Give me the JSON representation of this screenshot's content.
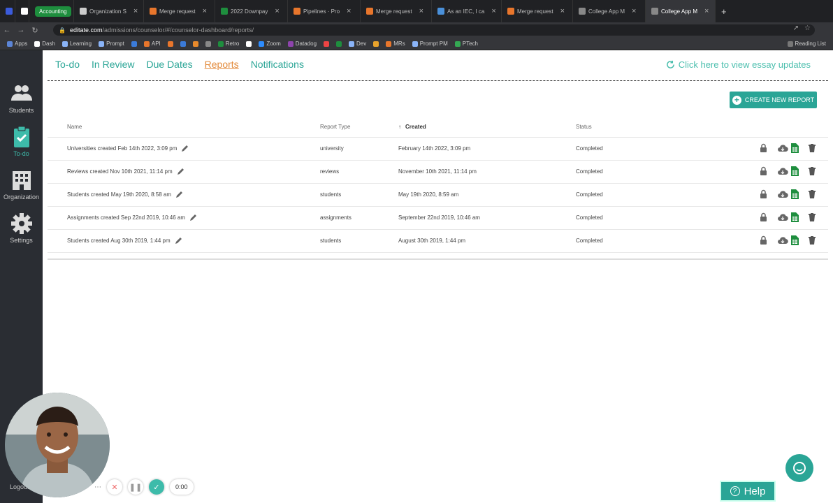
{
  "browser": {
    "tabs": [
      {
        "label": "",
        "icon": "word-icon",
        "color": "#3b5bdb"
      },
      {
        "label": "",
        "icon": "notion-icon",
        "color": "#ffffff"
      },
      {
        "label": "Accounting",
        "group": true
      },
      {
        "label": "Organization S",
        "icon": "doc-icon",
        "color": "#ccc"
      },
      {
        "label": "Merge request",
        "icon": "gitlab-icon",
        "color": "#e8762c"
      },
      {
        "label": "2022 Downpay",
        "icon": "sheets-icon",
        "color": "#1e8e3e"
      },
      {
        "label": "Pipelines · Pro",
        "icon": "gitlab-icon",
        "color": "#e8762c"
      },
      {
        "label": "Merge request",
        "icon": "gitlab-icon",
        "color": "#e8762c"
      },
      {
        "label": "As an IEC, I ca",
        "icon": "doc-icon",
        "color": "#4a90d9"
      },
      {
        "label": "Merge request",
        "icon": "gitlab-icon",
        "color": "#e8762c"
      },
      {
        "label": "College App M",
        "icon": "app-icon",
        "color": "#888"
      },
      {
        "label": "College App M",
        "icon": "app-icon",
        "color": "#888",
        "active": true
      }
    ],
    "url_host": "editate.com",
    "url_path": "/admissions/counselor/#/counselor-dashboard/reports/",
    "bookmarks": [
      "Apps",
      "Dash",
      "Learning",
      "Prompt",
      "",
      "API",
      "",
      "",
      "",
      "",
      "Retro",
      "",
      "Zoom",
      "Datadog",
      "",
      "",
      "Dev",
      "",
      "MRs",
      "Prompt PM",
      "PTech"
    ],
    "reading_list": "Reading List"
  },
  "sidebar": {
    "items": [
      {
        "label": "Students",
        "icon": "students-icon"
      },
      {
        "label": "To-do",
        "icon": "clipboard-check-icon",
        "active": true
      },
      {
        "label": "Organization",
        "icon": "building-icon"
      },
      {
        "label": "Settings",
        "icon": "gear-icon"
      }
    ],
    "logout": "Logout"
  },
  "topnav": {
    "items": [
      "To-do",
      "In Review",
      "Due Dates",
      "Reports",
      "Notifications"
    ],
    "active": "Reports",
    "essay_link": "Click here to view essay updates"
  },
  "create_button": "CREATE NEW REPORT",
  "table": {
    "headers": {
      "name": "Name",
      "type": "Report Type",
      "created": "Created",
      "status": "Status"
    },
    "rows": [
      {
        "name": "Universities created Feb 14th 2022, 3:09 pm",
        "type": "university",
        "created": "February 14th 2022, 3:09 pm",
        "status": "Completed"
      },
      {
        "name": "Reviews created Nov 10th 2021, 11:14 pm",
        "type": "reviews",
        "created": "November 10th 2021, 11:14 pm",
        "status": "Completed"
      },
      {
        "name": "Students created May 19th 2020, 8:58 am",
        "type": "students",
        "created": "May 19th 2020, 8:59 am",
        "status": "Completed"
      },
      {
        "name": "Assignments created Sep 22nd 2019, 10:46 am",
        "type": "assignments",
        "created": "September 22nd 2019, 10:46 am",
        "status": "Completed"
      },
      {
        "name": "Students created Aug 30th 2019, 1:44 pm",
        "type": "students",
        "created": "August 30th 2019, 1:44 pm",
        "status": "Completed"
      }
    ]
  },
  "recorder": {
    "timer": "0:00"
  },
  "help": {
    "label": "Help"
  },
  "colors": {
    "accent": "#2aa596",
    "active_nav": "#e38b3c",
    "sidebar": "#2a2d33"
  }
}
